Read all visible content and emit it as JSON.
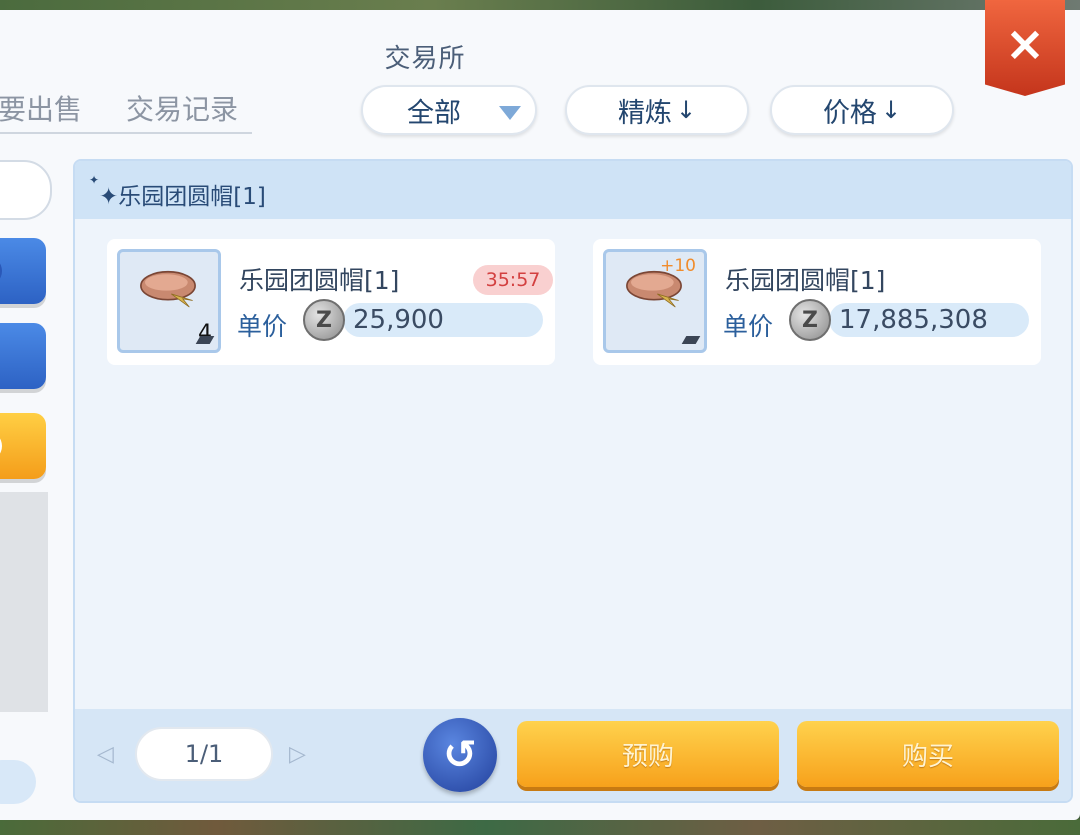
{
  "window": {
    "title": "交易所",
    "close_label": "×"
  },
  "tabs": [
    {
      "label": "要出售"
    },
    {
      "label": "交易记录"
    }
  ],
  "filters": {
    "category": "全部",
    "sort_refine": "精炼",
    "sort_price": "价格",
    "sort_arrow": "↓"
  },
  "section": {
    "title": "乐园团圆帽[1]"
  },
  "items": [
    {
      "name": "乐园团圆帽[1]",
      "timer": "35:57",
      "price_label": "单价",
      "price": "25,900",
      "quantity": "4",
      "refine": "",
      "currency_symbol": "Z"
    },
    {
      "name": "乐园团圆帽[1]",
      "timer": "",
      "price_label": "单价",
      "price": "17,885,308",
      "quantity": "",
      "refine": "+10",
      "currency_symbol": "Z"
    }
  ],
  "pagination": {
    "label": "1/1"
  },
  "actions": {
    "preorder": "预购",
    "buy": "购买",
    "refresh_icon": "refresh-icon"
  },
  "colors": {
    "accent_blue": "#23466f",
    "button_orange": "#f7a11b",
    "timer_red": "#d34040"
  }
}
